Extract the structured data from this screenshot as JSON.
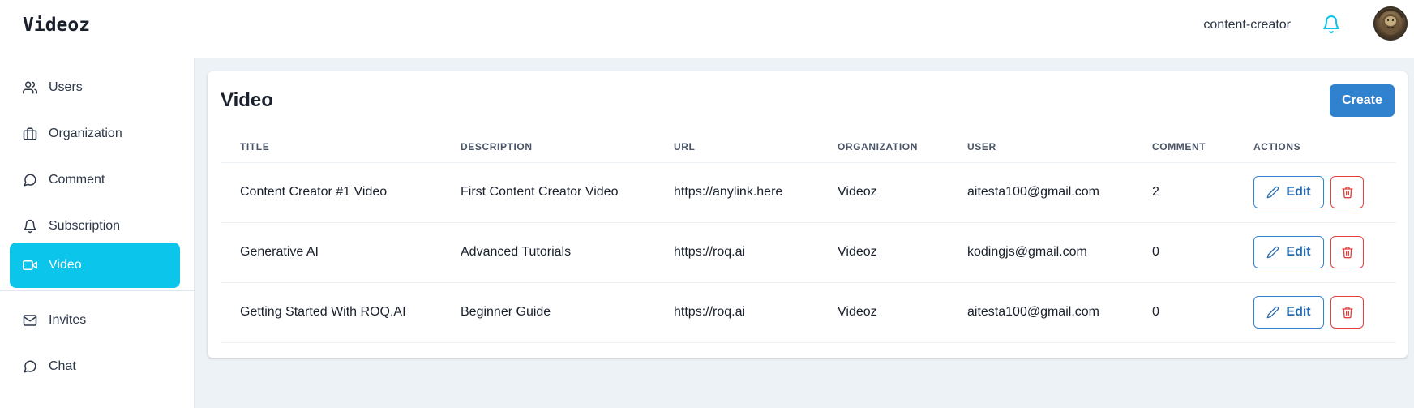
{
  "header": {
    "logo": "Videoz",
    "role": "content-creator",
    "bell_icon": "bell-icon",
    "accent": "#0bc5ea"
  },
  "sidebar": {
    "items": [
      {
        "label": "Users",
        "icon": "users-icon",
        "active": false
      },
      {
        "label": "Organization",
        "icon": "briefcase-icon",
        "active": false
      },
      {
        "label": "Comment",
        "icon": "chat-bubble-icon",
        "active": false
      },
      {
        "label": "Subscription",
        "icon": "bell-icon",
        "active": false
      },
      {
        "label": "Video",
        "icon": "video-icon",
        "active": true
      },
      {
        "label": "Invites",
        "icon": "mail-icon",
        "active": false
      },
      {
        "label": "Chat",
        "icon": "chat-bubble-icon",
        "active": false
      }
    ]
  },
  "page": {
    "title": "Video",
    "create_label": "Create"
  },
  "table": {
    "columns": [
      "Title",
      "Description",
      "URL",
      "Organization",
      "User",
      "Comment",
      "Actions"
    ],
    "rows": [
      {
        "title": "Content Creator #1 Video",
        "description": "First Content Creator Video",
        "url": "https://anylink.here",
        "organization": "Videoz",
        "user": "aitesta100@gmail.com",
        "comment": "2"
      },
      {
        "title": "Generative AI",
        "description": "Advanced Tutorials",
        "url": "https://roq.ai",
        "organization": "Videoz",
        "user": "kodingjs@gmail.com",
        "comment": "0"
      },
      {
        "title": "Getting Started With ROQ.AI",
        "description": "Beginner Guide",
        "url": "https://roq.ai",
        "organization": "Videoz",
        "user": "aitesta100@gmail.com",
        "comment": "0"
      }
    ],
    "edit_label": "Edit"
  },
  "colors": {
    "primary": "#3182ce",
    "danger": "#e53e3e",
    "active_nav": "#0bc5ea",
    "background": "#edf2f7"
  }
}
